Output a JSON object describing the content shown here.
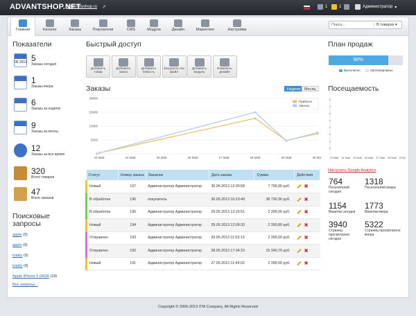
{
  "topbar": {
    "logo": "ADVANTSHOP.NET",
    "site_link": "http://myshop.ru",
    "icon_counts": [
      "1",
      "1",
      "0"
    ],
    "user": "Администратор"
  },
  "nav": {
    "items": [
      {
        "label": "Главная",
        "icon": "home-icon",
        "active": true,
        "dropdown": false
      },
      {
        "label": "Каталог",
        "icon": "catalog-icon",
        "active": false,
        "dropdown": true
      },
      {
        "label": "Заказы",
        "icon": "orders-icon",
        "active": false,
        "dropdown": true
      },
      {
        "label": "Покупатели",
        "icon": "customers-icon",
        "active": false,
        "dropdown": true
      },
      {
        "label": "CMS",
        "icon": "cms-icon",
        "active": false,
        "dropdown": true
      },
      {
        "label": "Модули",
        "icon": "modules-icon",
        "active": false,
        "dropdown": false
      },
      {
        "label": "Дизайн",
        "icon": "design-icon",
        "active": false,
        "dropdown": true
      },
      {
        "label": "Маркетинг",
        "icon": "marketing-icon",
        "active": false,
        "dropdown": true
      },
      {
        "label": "Настройки",
        "icon": "settings-icon",
        "active": false,
        "dropdown": true
      }
    ],
    "search_placeholder": "Поиск...",
    "search_scope": "В товарах"
  },
  "indicators": {
    "title": "Показатели",
    "items": [
      {
        "value": "5",
        "label": "Заказы сегодня",
        "icon": "calendar-day-icon",
        "cal_text": "06.2013"
      },
      {
        "value": "1",
        "label": "Заказы вчера",
        "icon": "calendar-icon",
        "cal_text": ""
      },
      {
        "value": "6",
        "label": "Заказы за неделю",
        "icon": "calendar-week-icon",
        "cal_text": ""
      },
      {
        "value": "9",
        "label": "Заказы за месяц",
        "icon": "calendar-month-icon",
        "cal_text": ""
      },
      {
        "value": "12",
        "label": "Заказы за все время",
        "icon": "clock-icon",
        "cal_text": ""
      },
      {
        "value": "320",
        "label": "Всего товаров",
        "icon": "box-icon",
        "cal_text": ""
      },
      {
        "value": "47",
        "label": "Всего заказов",
        "icon": "coins-icon",
        "cal_text": ""
      }
    ]
  },
  "search_queries": {
    "title": "Поисковые запросы",
    "items": [
      {
        "term": "apple",
        "count": "(9)"
      },
      {
        "term": "apple",
        "count": "(9)"
      },
      {
        "term": "totally",
        "count": "(9)"
      },
      {
        "term": "totally",
        "count": "(9)"
      },
      {
        "term": "Apple iPhone 5 64GB",
        "count": "(18)"
      }
    ],
    "all_link": "Все запросы..."
  },
  "quick_access": {
    "title": "Быстрый доступ",
    "items": [
      {
        "label": "Добавить товар",
        "icon": "add-product-icon"
      },
      {
        "label": "Добавить заказ",
        "icon": "add-order-icon"
      },
      {
        "label": "Добавить новость",
        "icon": "add-news-icon"
      },
      {
        "label": "Загрузить csv файл",
        "icon": "csv-upload-icon"
      },
      {
        "label": "Добавить модуль",
        "icon": "add-module-icon"
      },
      {
        "label": "Изменить дизайн",
        "icon": "edit-design-icon"
      }
    ]
  },
  "orders_chart": {
    "title": "Заказы",
    "tabs": [
      "Неделя",
      "Месяц"
    ],
    "active_tab": "Неделя",
    "legend": [
      "Прибыль",
      "Заказы"
    ]
  },
  "chart_data": {
    "type": "line",
    "x": [
      "23 Май",
      "24 Май",
      "25 Май",
      "26 Май",
      "27 Май",
      "28 Май",
      "29 Май",
      "30 Май"
    ],
    "y_ticks": [
      "0",
      "5000",
      "10000",
      "15000",
      "20000"
    ],
    "ylim": [
      0,
      20000
    ],
    "series": [
      {
        "name": "Прибыль",
        "color": "#e6c36a",
        "values": [
          300,
          null,
          null,
          null,
          null,
          12800,
          4800,
          7300
        ]
      },
      {
        "name": "Заказы",
        "color": "#b5cde6",
        "values": [
          300,
          null,
          null,
          null,
          null,
          15000,
          4700,
          7700
        ]
      }
    ],
    "legend_position": "top-right",
    "grid": true
  },
  "orders_table": {
    "headers": [
      "Статус",
      "Номер заказа",
      "Заказчик",
      "Дата заказа",
      "Сумма",
      "Действия"
    ],
    "rows": [
      {
        "status": "Новый",
        "status_color": "#f1c232",
        "number": "197",
        "customer": "Администратор Администратор",
        "date": "30.05.2013 12:09:58",
        "sum": "7 799,00 руб."
      },
      {
        "status": "В обработке",
        "status_color": "#6fcf4f",
        "number": "196",
        "customer": "покупатель",
        "date": "30.05.2013 10:23:49",
        "sum": "38 790,30 руб."
      },
      {
        "status": "В обработке",
        "status_color": "#6fcf4f",
        "number": "195",
        "customer": "Администратор Администратор",
        "date": "29.05.2013 12:10:51",
        "sum": "2 399,00 руб."
      },
      {
        "status": "Новый",
        "status_color": "#f1c232",
        "number": "194",
        "customer": "Администратор Администратор",
        "date": "29.05.2013 12:09:33",
        "sum": "2 350,80 руб."
      },
      {
        "status": "Отправлен",
        "status_color": "#e56bd8",
        "number": "193",
        "customer": "Администратор Администратор",
        "date": "29.05.2013 11:53:13",
        "sum": "2 399,00 руб."
      },
      {
        "status": "Отправлен",
        "status_color": "#e56bd8",
        "number": "192",
        "customer": "Администратор Администратор",
        "date": "28.05.2013 17:34:10",
        "sum": "15 340,70 руб."
      },
      {
        "status": "Новый",
        "status_color": "#f1c232",
        "number": "191",
        "customer": "Администратор Администратор",
        "date": "27.05.2013 11:44:02",
        "sum": "2 399,00 руб."
      }
    ]
  },
  "sales_plan": {
    "title": "План продаж",
    "percent_label": "80%",
    "fraction": 0.8,
    "legend": [
      "Выполнено",
      "Запланировано"
    ]
  },
  "attendance": {
    "title": "Посещаемость",
    "x": [
      "23 Май",
      "24 Май",
      "25 Май",
      "26 Май",
      "27 Май",
      "28 Май",
      "29 Май"
    ]
  },
  "analytics": {
    "link": "Настроить Google Analytics",
    "stats": [
      {
        "value": "764",
        "label": "Посетителей сегодня"
      },
      {
        "value": "1318",
        "label": "Посетителей вчера"
      },
      {
        "value": "1154",
        "label": "Визитов сегодня"
      },
      {
        "value": "1773",
        "label": "Визитов вчера"
      },
      {
        "value": "3940",
        "label": "Страниц просмотрено сегодня"
      },
      {
        "value": "5322",
        "label": "Страниц просмотрено вчера"
      }
    ]
  },
  "footer": {
    "text": "Copyright © 2006-2013 ITM Company, All Rights Reserved"
  }
}
